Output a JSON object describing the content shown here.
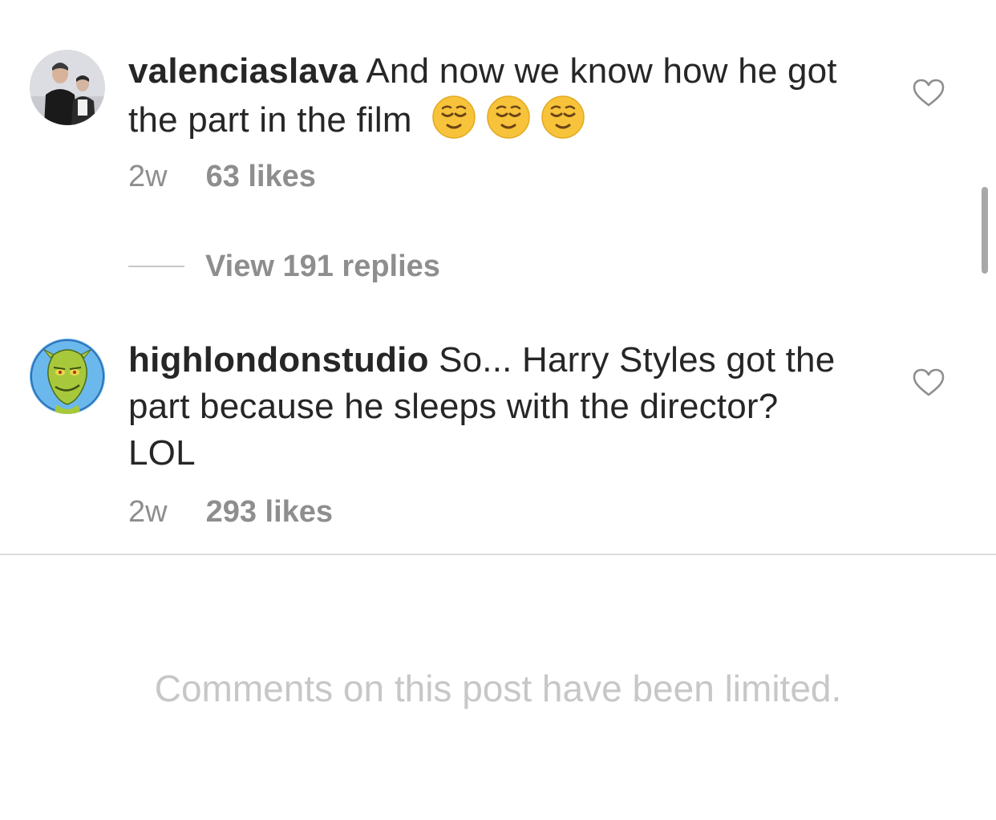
{
  "comments": [
    {
      "username": "valenciaslava",
      "text": " And now we know how he got the part in the film",
      "emoji": "😌 😌 😌",
      "time": "2w",
      "likes": "63 likes",
      "avatar_icon": "person-photo-avatar"
    },
    {
      "username": "highlondonstudio",
      "text": " So... Harry Styles got the part because he sleeps with the director? LOL",
      "time": "2w",
      "likes": "293 likes",
      "avatar_icon": "grinch-avatar"
    }
  ],
  "replies": {
    "label": "View 191 replies"
  },
  "footer": {
    "limited_text": "Comments on this post have been limited."
  },
  "colors": {
    "text": "#262626",
    "meta": "#8e8e8e",
    "limited": "#c7c7c7",
    "divider": "#dbdbdb"
  },
  "icons": [
    "heart-icon",
    "relieved-face-emoji",
    "scrollbar"
  ]
}
